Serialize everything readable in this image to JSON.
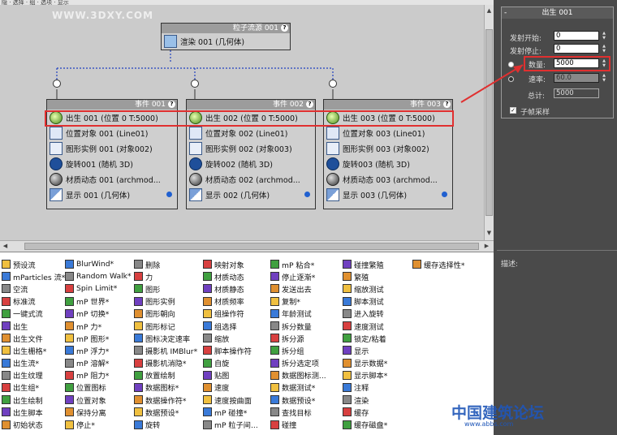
{
  "menubar": {
    "text": "隐 · 选择 · 组 · 选项 · 显示"
  },
  "watermark": "WWW.3DXY.COM",
  "source_node": {
    "title": "粒子流源 001",
    "rows": [
      {
        "icon": "render-icon",
        "label": "渲染 001 (几何体)"
      }
    ]
  },
  "events": [
    {
      "title": "事件 001",
      "rows": [
        {
          "icon": "birth-icon",
          "label": "出生 001 (位置 0 T:5000)"
        },
        {
          "icon": "position-icon",
          "label": "位置对象 001 (Line01)"
        },
        {
          "icon": "shape-instance-icon",
          "label": "图形实例 001 (对象002)"
        },
        {
          "icon": "rotation-icon",
          "label": "旋转001 (随机 3D)"
        },
        {
          "icon": "material-icon",
          "label": "材质动态 001 (archmod..."
        },
        {
          "icon": "display-icon",
          "label": "显示 001 (几何体)"
        }
      ]
    },
    {
      "title": "事件 002",
      "rows": [
        {
          "icon": "birth-icon",
          "label": "出生 002 (位置 0 T:5000)"
        },
        {
          "icon": "position-icon",
          "label": "位置对象 002 (Line01)"
        },
        {
          "icon": "shape-instance-icon",
          "label": "图形实例 002 (对象003)"
        },
        {
          "icon": "rotation-icon",
          "label": "旋转002 (随机 3D)"
        },
        {
          "icon": "material-icon",
          "label": "材质动态 002 (archmod..."
        },
        {
          "icon": "display-icon",
          "label": "显示 002 (几何体)"
        }
      ]
    },
    {
      "title": "事件 003",
      "rows": [
        {
          "icon": "birth-icon",
          "label": "出生 003 (位置 0 T:5000)"
        },
        {
          "icon": "position-icon",
          "label": "位置对象 003 (Line01)"
        },
        {
          "icon": "shape-instance-icon",
          "label": "图形实例 003 (对象002)"
        },
        {
          "icon": "rotation-icon",
          "label": "旋转003 (随机 3D)"
        },
        {
          "icon": "material-icon",
          "label": "材质动态 003 (archmod..."
        },
        {
          "icon": "display-icon",
          "label": "显示 003 (几何体)"
        }
      ]
    }
  ],
  "params": {
    "title": "出生 001",
    "emit_start_label": "发射开始:",
    "emit_start": "0",
    "emit_stop_label": "发射停止:",
    "emit_stop": "0",
    "amount_label": "数量:",
    "amount": "5000",
    "rate_label": "速率:",
    "rate": "60.0",
    "total_label": "总计:",
    "total": "5000",
    "subframe_label": "子帧采样"
  },
  "description_label": "描述:",
  "depot": [
    [
      "预设流",
      "mParticles 流*",
      "空流",
      "标准流",
      "一键式流",
      "出生",
      "出生文件",
      "出生栅格*",
      "出生流*",
      "出生纹理",
      "出生组*",
      "出生绘制",
      "出生脚本",
      "初始状态"
    ],
    [
      "BlurWind*",
      "Random Walk*",
      "Spin Limit*",
      "mP 世界*",
      "mP 切换*",
      "mP 力*",
      "mP 图形*",
      "mP 浮力*",
      "mP 溶解*",
      "mP 阻力*",
      "位置图标",
      "位置对象",
      "保持分离",
      "停止*"
    ],
    [
      "删除",
      "力",
      "图形",
      "图形实例",
      "图形朝向",
      "图形标记",
      "图标决定速率",
      "摄影机 IMBlur*",
      "摄影机消隐*",
      "放置绘制",
      "数据图标*",
      "数据操作符*",
      "数据预设*",
      "旋转"
    ],
    [
      "映射对象",
      "材质动态",
      "材质静态",
      "材质频率",
      "组操作符",
      "组选择",
      "缩放",
      "脚本操作符",
      "自旋",
      "贴图",
      "速度",
      "速度按曲面",
      "mP 碰撞*",
      "mP 粒子间..."
    ],
    [
      "mP 粘合*",
      "停止逐渐*",
      "发送出去",
      "复制*",
      "年龄测试",
      "拆分数量",
      "拆分源",
      "拆分组",
      "拆分选定项",
      "数据图标测...",
      "数据测试*",
      "数据预设*",
      "查找目标",
      "碰撞"
    ],
    [
      "碰撞繁殖",
      "繁殖",
      "缩放测试",
      "脚本测试",
      "进入旋转",
      "速度测试",
      "锁定/粘着",
      "显示",
      "显示数据*",
      "显示脚本*",
      "注释",
      "渲染",
      "缓存",
      "缓存磁盘*"
    ],
    [
      "缓存选择性*"
    ]
  ],
  "brand": {
    "name": "中国建筑论坛",
    "sub": "www.abbs.com"
  }
}
